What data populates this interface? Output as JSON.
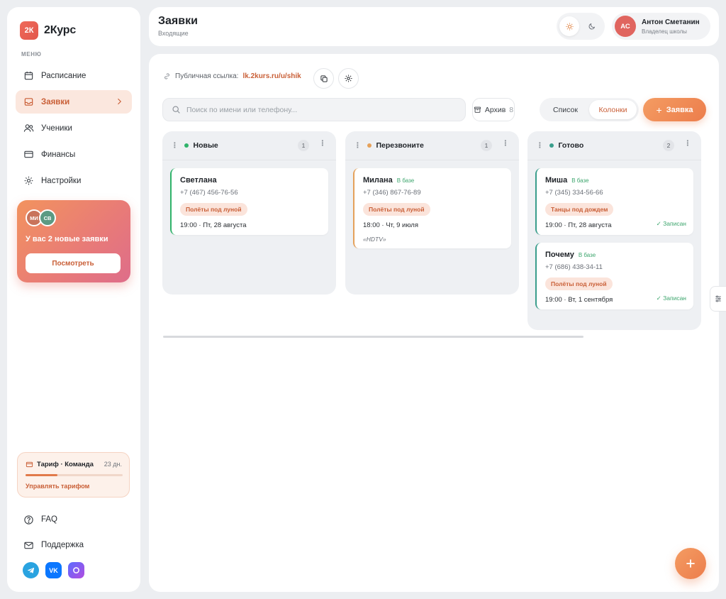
{
  "app": {
    "logo_mark": "2К",
    "name": "2Курс"
  },
  "sidebar": {
    "menu_caption": "МЕНЮ",
    "items": [
      {
        "label": "Расписание",
        "icon": "calendar-icon"
      },
      {
        "label": "Заявки",
        "icon": "inbox-icon",
        "active": true
      },
      {
        "label": "Ученики",
        "icon": "users-icon"
      },
      {
        "label": "Финансы",
        "icon": "card-icon"
      },
      {
        "label": "Настройки",
        "icon": "gear-icon"
      }
    ],
    "promo": {
      "avatars": [
        "МИ",
        "СВ"
      ],
      "text": "У вас 2 новые заявки",
      "button": "Посмотреть"
    },
    "tariff": {
      "title": "Тариф · Команда",
      "days": "23 дн.",
      "progress": 0.33,
      "link": "Управлять тарифом"
    },
    "bottom": [
      {
        "label": "FAQ",
        "icon": "help-icon"
      },
      {
        "label": "Поддержка",
        "icon": "mail-icon"
      }
    ],
    "socials": [
      "telegram-icon",
      "vk-icon",
      "max-icon"
    ]
  },
  "header": {
    "title": "Заявки",
    "subtitle": "Входящие",
    "user": {
      "initials": "АС",
      "name": "Антон Сметанин",
      "role": "Владелец школы"
    }
  },
  "toolbar": {
    "public_label": "Публичная ссылка:",
    "public_link": "lk.2kurs.ru/u/shik",
    "search_placeholder": "Поиск по имени или телефону...",
    "archive_label": "Архив",
    "archive_count": "8",
    "view_list": "Список",
    "view_columns": "Колонки",
    "add_label": "Заявка"
  },
  "columns": [
    {
      "title": "Новые",
      "count": "1",
      "color": "#2fb36a",
      "cards": [
        {
          "name": "Светлана",
          "base": "",
          "phone": "+7 (467) 456-76-56",
          "tag": "Полёты под луной",
          "time": "19:00 · Пт, 28 августа",
          "note": "",
          "status": ""
        }
      ]
    },
    {
      "title": "Перезвоните",
      "count": "1",
      "color": "#e5a15a",
      "cards": [
        {
          "name": "Милана",
          "base": "В базе",
          "phone": "+7 (346) 867-76-89",
          "tag": "Полёты под луной",
          "time": "18:00 · Чт, 9 июля",
          "note": "«HDTV»",
          "status": ""
        }
      ]
    },
    {
      "title": "Готово",
      "count": "2",
      "color": "#3a9e8c",
      "cards": [
        {
          "name": "Миша",
          "base": "В базе",
          "phone": "+7 (345) 334-56-66",
          "tag": "Танцы под дождем",
          "time": "19:00 · Пт, 28 августа",
          "note": "",
          "status": "✓ Записан"
        },
        {
          "name": "Почему",
          "base": "В базе",
          "phone": "+7 (686) 438-34-11",
          "tag": "Полёты под луной",
          "time": "19:00 · Вт, 1 сентября",
          "note": "",
          "status": "✓ Записан"
        }
      ]
    }
  ]
}
